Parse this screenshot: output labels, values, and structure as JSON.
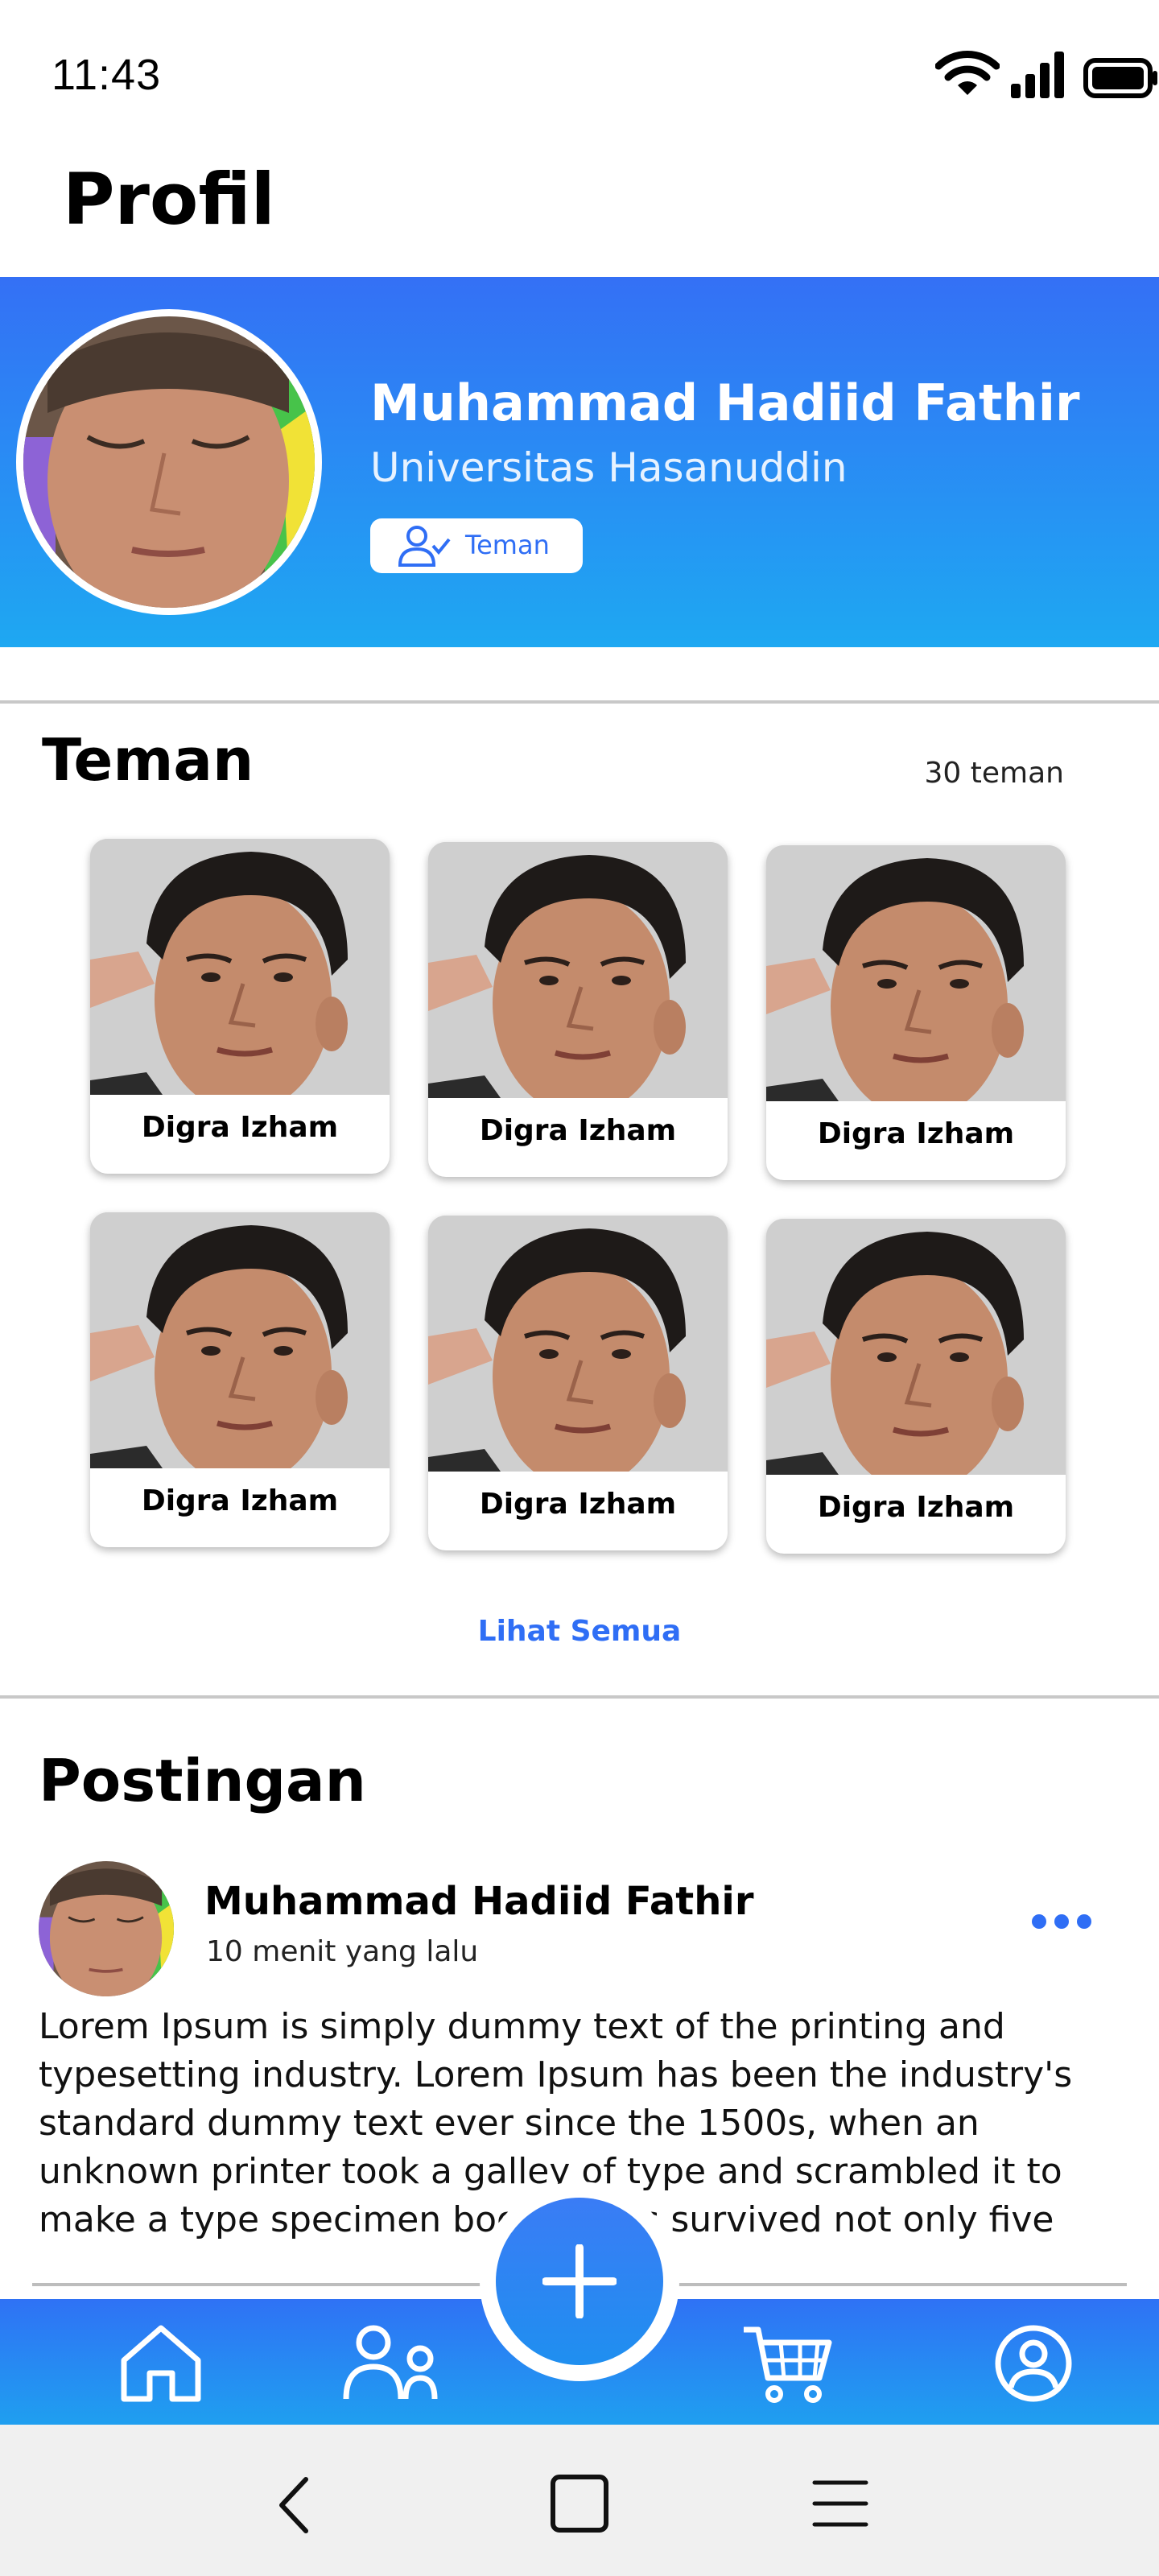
{
  "status_bar": {
    "time": "11:43"
  },
  "header": {
    "title": "Profil"
  },
  "profile": {
    "name": "Muhammad Hadiid Fathir",
    "university": "Universitas Hasanuddin",
    "badge_label": "Teman"
  },
  "friends": {
    "title": "Teman",
    "count_label": "30 teman",
    "items": [
      {
        "name": "Digra Izham"
      },
      {
        "name": "Digra Izham"
      },
      {
        "name": "Digra Izham"
      },
      {
        "name": "Digra Izham"
      },
      {
        "name": "Digra Izham"
      },
      {
        "name": "Digra Izham"
      }
    ],
    "see_all_label": "Lihat Semua"
  },
  "posts": {
    "title": "Postingan",
    "items": [
      {
        "author": "Muhammad Hadiid Fathir",
        "time": "10 menit yang lalu",
        "text": "Lorem Ipsum is simply dummy text of the printing and typesetting industry. Lorem Ipsum has been the industry's standard dummy text ever since the 1500s, when an unknown printer took a galley of type and scrambled it to make a type specimen book. It has survived not only five centur"
      }
    ]
  },
  "bottom_nav": {
    "items": [
      {
        "icon": "home-icon"
      },
      {
        "icon": "friends-icon"
      },
      {
        "icon": "plus-icon"
      },
      {
        "icon": "cart-icon"
      },
      {
        "icon": "account-icon"
      }
    ]
  },
  "system_nav": {
    "items": [
      "back-icon",
      "home-square-icon",
      "menu-icon"
    ]
  },
  "colors": {
    "primary": "#2f6ef5",
    "gradient_end": "#1ea8f2"
  }
}
